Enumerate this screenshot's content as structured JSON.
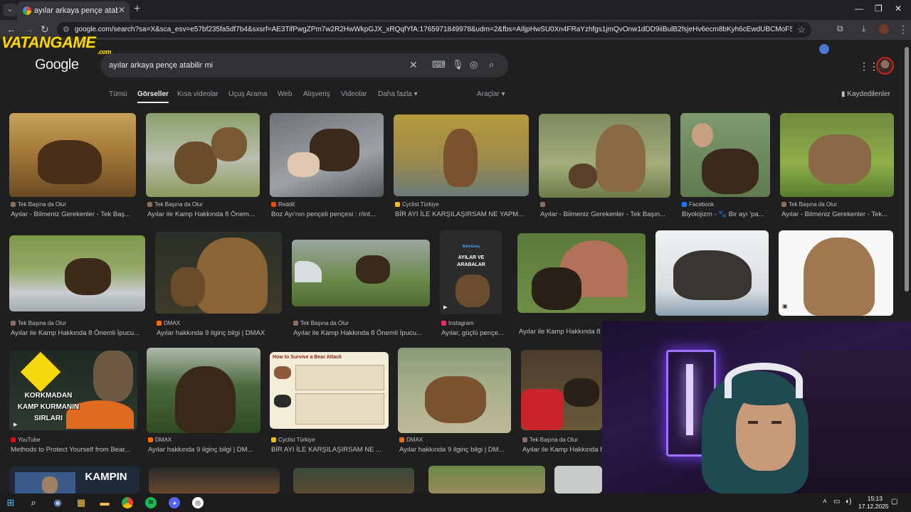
{
  "browser": {
    "tab_title": "ayılar arkaya pençe atabilir mi",
    "url": "google.com/search?sa=X&sca_esv=e57bf235fa5df7b4&sxsrf=AE3TifPwgZPm7w2R2HwWkpGJX_xRQqfYfA:1765971849978&udm=2&fbs=AIljpHwSU0Xn4FRaYzhfgs1jmQvOnw1dDD9iiBulB2fsjeHv6ecm8bKyh6cEwdUBCMoFSBfCmcN8r0zRavgsp..."
  },
  "google": {
    "logo": "Google",
    "query": "ayılar arkaya pençe atabilir mi",
    "tabs": [
      "Tümü",
      "Görseller",
      "Kısa videolar",
      "Uçuş Arama",
      "Web",
      "Alışveriş",
      "Videolar",
      "Daha fazla ▾"
    ],
    "tools": "Araçlar ▾",
    "saved": "Kaydedilenler"
  },
  "results": [
    {
      "source": "Tek Başına da Olur",
      "caption": "Ayılar - Bilmeniz Gerekenler - Tek Baş...",
      "color": "#8d6e63"
    },
    {
      "source": "Tek Başına da Olur",
      "caption": "Ayılar ile Kamp Hakkında 8 Önem...",
      "color": "#34a853"
    },
    {
      "source": "Reddit",
      "caption": "Boz Ayı'nın pençeli pençesi : r/int...",
      "color": "#ff4500"
    },
    {
      "source": "Cyclist Türkiye",
      "caption": "BİR AYI İLE KARŞILAŞIRSAM NE YAPM...",
      "color": "#fbbc05"
    },
    {
      "source": "",
      "caption": "Ayılar - Bilmeniz Gerekenler - Tek Başın...",
      "color": "#8d6e63"
    },
    {
      "source": "Facebook",
      "caption": "Biyolojizm - 🐾 Bir ayı 'pa...",
      "color": "#1877f2"
    },
    {
      "source": "Tek Başına da Olur",
      "caption": "Ayılar - Bilmeniz Gerekenler - Tek...",
      "color": "#8d6e63"
    },
    {
      "source": "Tek Başına da Olur",
      "caption": "Ayılar ile Kamp Hakkında 8 Önemli İpucu...",
      "color": "#8d6e63"
    },
    {
      "source": "DMAX",
      "caption": "Ayılar hakkında 9 ilginç bilgi | DMAX",
      "color": "#ff6d00"
    },
    {
      "source": "Tek Başına da Olur",
      "caption": "Ayılar ile Kamp Hakkında 8 Önemli İpucu...",
      "color": "#8d6e63"
    },
    {
      "source": "Instagram",
      "caption": "Ayılar, güçlü pençe...",
      "color": "#e1306c"
    },
    {
      "source": "",
      "caption": "Ayılar ile Kamp Hakkında 8",
      "color": "#8d6e63"
    },
    {
      "source": "YouTube",
      "caption": "Methods to Protect Yourself from Bear...",
      "color": "#ff0000"
    },
    {
      "source": "DMAX",
      "caption": "Ayılar hakkında 9 ilginç bilgi | DM...",
      "color": "#ff6d00"
    },
    {
      "source": "Cyclist Türkiye",
      "caption": "BİR AYI İLE KARŞILAŞIRSAM NE ...",
      "color": "#fbbc05"
    },
    {
      "source": "DMAX",
      "caption": "Ayılar hakkında 9 ilginç bilgi | DM...",
      "color": "#ff6d00"
    },
    {
      "source": "Tek Başına da Olur",
      "caption": "Ayılar ile Kamp Hakkında 8",
      "color": "#8d6e63"
    }
  ],
  "thumb_text": {
    "yt_title_1": "KORKMADAN",
    "yt_title_2": "KAMP KURMANIN",
    "yt_title_3": "SIRLARI",
    "insta_brand": "BilimGenç",
    "insta_title": "AYILAR VE ARABALAR",
    "poster_title": "How to Survive a Bear Attack",
    "kampin": "KAMPIN"
  },
  "watermark": {
    "text": "VATANGAME",
    "suffix": ".com"
  },
  "taskbar": {
    "time": "15:13",
    "date": "17.12.2025"
  }
}
